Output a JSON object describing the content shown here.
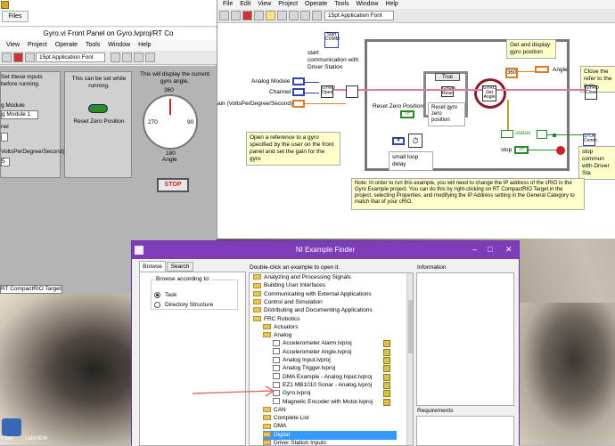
{
  "front_panel": {
    "files_tab": "Files",
    "title": "Gyro.vi Front Panel on Gyro.lvproj/RT Co",
    "menus": [
      "View",
      "Project",
      "Operate",
      "Tools",
      "Window",
      "Help"
    ],
    "font_selector": "15pt Application Font",
    "hint_inputs": "Set these inputs before running.",
    "hint_running": "This can be set while running.",
    "hint_gyro": "This will display the current gyro angle.",
    "analog_module_label": "g Module",
    "analog_module_value": "g Module 1",
    "channel_label": "nel",
    "gain_label": "VoltsPerDegree/Second)",
    "gain_value": "5",
    "zero_button_label": "Reset Zero Position",
    "gauge_top": "360",
    "gauge_left": "270",
    "gauge_right": "90",
    "gauge_bottom": "180",
    "angle_label": "Angle",
    "stop_label": "STOP",
    "target_label": "RT CompactRIO Target"
  },
  "block_diagram": {
    "menus": [
      "File",
      "Edit",
      "View",
      "Project",
      "Operate",
      "Tools",
      "Window",
      "Help"
    ],
    "font_selector": "15pt Application Font",
    "start_comm_note": "start communication with Driver Station",
    "start_comm_node": "Start COMM",
    "get_gyro_note": "Get and display gyro position",
    "close_ref_note": "Close the refer to the gyro",
    "stop_comm_note": "stop commun with Driver Sta",
    "stop_comm_node": "STOP Comm",
    "open_note": "Open a reference to a gyro specified by the user on the front panel and set the gain for the gyro",
    "label_analog": "Analog Module",
    "label_channel": "Channel",
    "label_gain": "ain (VoltsPerDegree/Second)",
    "label_reset": "Reset Zero Position",
    "label_reset_gyro": "Reset gyro zero position",
    "case_true": "True",
    "angle_indicator": "360",
    "angle_label": "Angle",
    "status_label": "status",
    "stop_label": "stop",
    "tf_value": "TF",
    "delay_label": "small loop delay",
    "delay_value": "4",
    "node_open": "GYRO Open",
    "node_reset": "GYRO Reset",
    "node_get": "GYRO Get Angle",
    "node_close": "GYRO Close",
    "footnote": "Note:  In order to run this example, you will need to change the IP address of the cRIO in the Gyro Example project.  You can do this by right-clicking on RT CompactRIO Target in the project, selecting Properties, and modifying the IP Address setting in the General Category to match that of your cRIO."
  },
  "example_finder": {
    "title": "NI Example Finder",
    "tabs": [
      "Browse",
      "Search"
    ],
    "browse_by": "Browse according to:",
    "options": [
      "Task",
      "Directory Structure"
    ],
    "selected_option": "Task",
    "instruction": "Double-click an example to open it.",
    "info_label": "Information",
    "requirements_label": "Requirements",
    "tree": [
      {
        "label": "Analyzing and Processing Signals",
        "type": "folder",
        "indent": 0
      },
      {
        "label": "Building User Interfaces",
        "type": "folder",
        "indent": 0
      },
      {
        "label": "Communicating with External Applications",
        "type": "folder",
        "indent": 0
      },
      {
        "label": "Control and Simulation",
        "type": "folder",
        "indent": 0
      },
      {
        "label": "Distributing and Documenting Applications",
        "type": "folder",
        "indent": 0
      },
      {
        "label": "FRC Robotics",
        "type": "folder",
        "indent": 0
      },
      {
        "label": "Actuators",
        "type": "folder",
        "indent": 1
      },
      {
        "label": "Analog",
        "type": "folder",
        "indent": 1
      },
      {
        "label": "Accelerometer Alarm.lvproj",
        "type": "file",
        "indent": 2
      },
      {
        "label": "Accelerometer Angle.lvproj",
        "type": "file",
        "indent": 2
      },
      {
        "label": "Analog Input.lvproj",
        "type": "file",
        "indent": 2
      },
      {
        "label": "Analog Trigger.lvproj",
        "type": "file",
        "indent": 2
      },
      {
        "label": "DMA Example - Analog Input.lvproj",
        "type": "file",
        "indent": 2
      },
      {
        "label": "EZ1 MB1010 Sonar - Analog.lvproj",
        "type": "file",
        "indent": 2
      },
      {
        "label": "Gyro.lvproj",
        "type": "file",
        "indent": 2
      },
      {
        "label": "Magnetic Encoder with Motor.lvproj",
        "type": "file",
        "indent": 2
      },
      {
        "label": "CAN",
        "type": "folder",
        "indent": 1
      },
      {
        "label": "Complete List",
        "type": "folder",
        "indent": 1
      },
      {
        "label": "DMA",
        "type": "folder",
        "indent": 1
      },
      {
        "label": "Digital",
        "type": "folder",
        "indent": 1,
        "selected": true
      },
      {
        "label": "Driver Station Inputs",
        "type": "folder",
        "indent": 1
      }
    ]
  },
  "taskbar": {
    "icon_label": "Files",
    "icon_caption": "LabVIEW"
  },
  "colors": {
    "finder_title": "#7d3cb8",
    "selection": "#3399ff",
    "wire_blue": "#2f45a8",
    "wire_pink": "#e07aa8",
    "wire_green": "#2a8a2a",
    "highlight_circle": "#8b1a2b",
    "arrow": "#e06a6a"
  }
}
